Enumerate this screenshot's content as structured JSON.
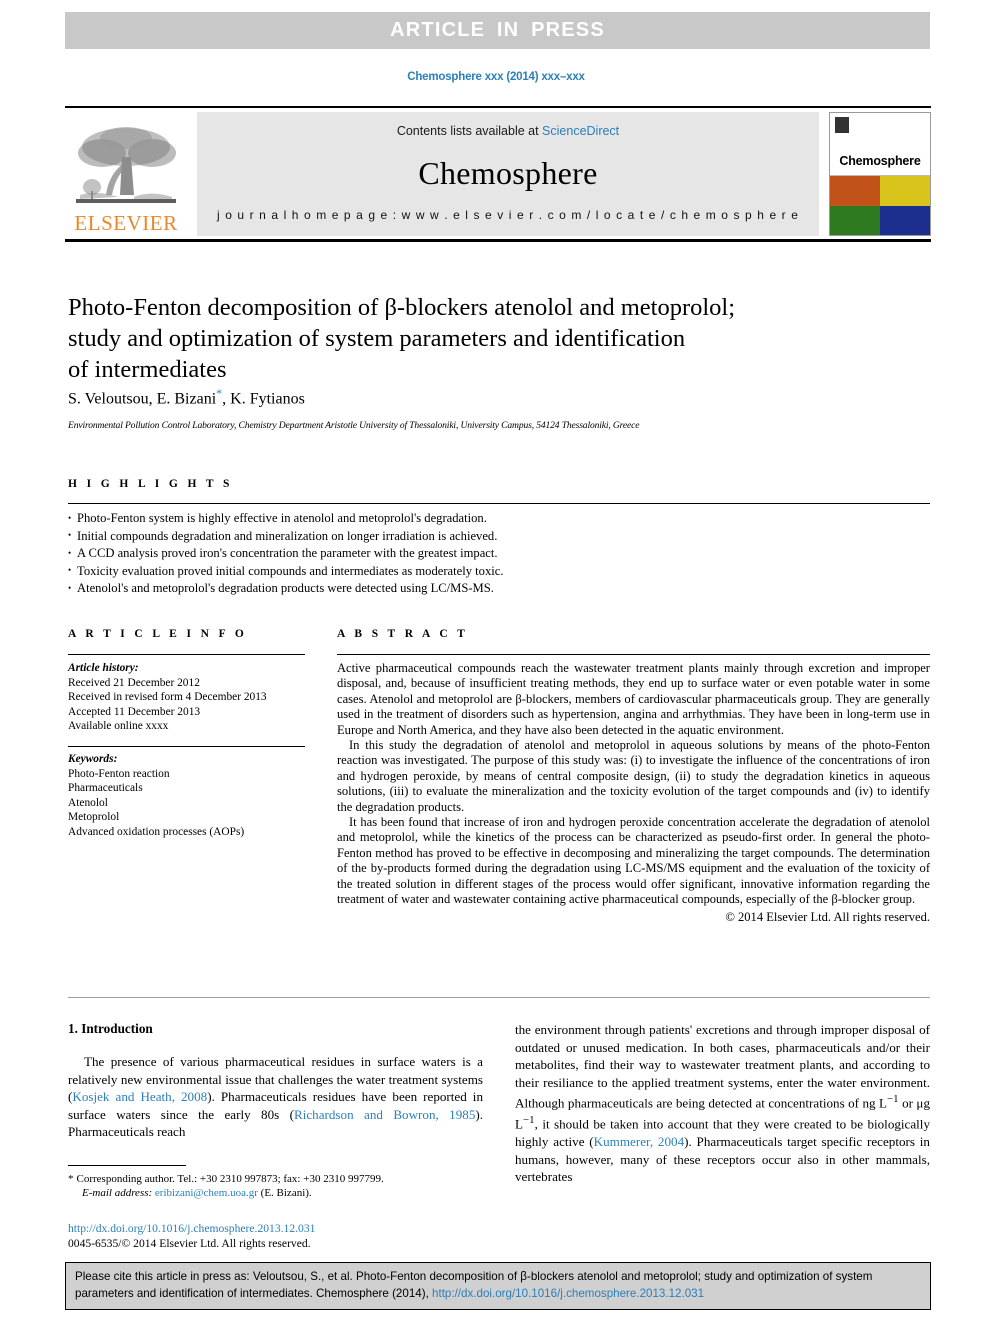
{
  "banner": {
    "text": "ARTICLE  IN  PRESS"
  },
  "running_head": "Chemosphere xxx (2014) xxx–xxx",
  "masthead": {
    "contents_prefix": "Contents lists available at ",
    "sciencedirect": "ScienceDirect",
    "journal_name": "Chemosphere",
    "homepage": "j o u r n a l   h o m e p a g e :   w w w . e l s e v i e r . c o m / l o c a t e / c h e m o s p h e r e",
    "elsevier_wordmark": "ELSEVIER",
    "cover_title": "Chemosphere",
    "cover_colors": [
      "#c0521a",
      "#d8c41b",
      "#2e7a1e",
      "#1c2f8e"
    ],
    "link_color": "#2b7fb9"
  },
  "article": {
    "title_line1": "Photo-Fenton decomposition of β-blockers atenolol and metoprolol;",
    "title_line2": "study and optimization of system parameters and identification",
    "title_line3": "of intermediates",
    "authors_part1": "S. Veloutsou, E. Bizani",
    "authors_star": "*",
    "authors_part2": ", K. Fytianos",
    "affiliation": "Environmental Pollution Control Laboratory, Chemistry Department Aristotle University of Thessaloniki, University Campus, 54124 Thessaloniki, Greece"
  },
  "highlights": {
    "label": "H I G H L I G H T S",
    "items": [
      "Photo-Fenton system is highly effective in atenolol and metoprolol's degradation.",
      "Initial compounds degradation and mineralization on longer irradiation is achieved.",
      "A CCD analysis proved iron's concentration the parameter with the greatest impact.",
      "Toxicity evaluation proved initial compounds and intermediates as moderately toxic.",
      "Atenolol's and metoprolol's degradation products were detected using LC/MS-MS."
    ]
  },
  "article_info": {
    "label": "A R T I C L E    I N F O",
    "history_heading": "Article history:",
    "history": [
      "Received 21 December 2012",
      "Received in revised form 4 December 2013",
      "Accepted 11 December 2013",
      "Available online xxxx"
    ],
    "keywords_heading": "Keywords:",
    "keywords": [
      "Photo-Fenton reaction",
      "Pharmaceuticals",
      "Atenolol",
      "Metoprolol",
      "Advanced oxidation processes (AOPs)"
    ]
  },
  "abstract": {
    "label": "A B S T R A C T",
    "paragraphs": [
      "Active pharmaceutical compounds reach the wastewater treatment plants mainly through excretion and improper disposal, and, because of insufficient treating methods, they end up to surface water or even potable water in some cases. Atenolol and metoprolol are β-blockers, members of cardiovascular pharmaceuticals group. They are generally used in the treatment of disorders such as hypertension, angina and arrhythmias. They have been in long-term use in Europe and North America, and they have also been detected in the aquatic environment.",
      "In this study the degradation of atenolol and metoprolol in aqueous solutions by means of the photo-Fenton reaction was investigated. The purpose of this study was: (i) to investigate the influence of the concentrations of iron and hydrogen peroxide, by means of central composite design, (ii) to study the degradation kinetics in aqueous solutions, (iii) to evaluate the mineralization and the toxicity evolution of the target compounds and (iv) to identify the degradation products.",
      "It has been found that increase of iron and hydrogen peroxide concentration accelerate the degradation of atenolol and metoprolol, while the kinetics of the process can be characterized as pseudo-first order. In general the photo-Fenton method has proved to be effective in decomposing and mineralizing the target compounds. The determination of the by-products formed during the degradation using LC-MS/MS equipment and the evaluation of the toxicity of the treated solution in different stages of the process would offer significant, innovative information regarding the treatment of water and wastewater containing active pharmaceutical compounds, especially of the β-blocker group."
    ],
    "copyright": "© 2014 Elsevier Ltd. All rights reserved."
  },
  "introduction": {
    "heading": "1. Introduction",
    "left_p1_a": "The presence of various pharmaceutical residues in surface waters is a relatively new environmental issue that challenges the water treatment systems (",
    "left_ref1": "Kosjek and Heath, 2008",
    "left_p1_b": "). Pharmaceuticals residues have been reported in surface waters since the early 80s (",
    "left_ref2": "Richardson and Bowron, 1985",
    "left_p1_c": "). Pharmaceuticals reach",
    "right_p1_a": "the environment through patients' excretions and through improper disposal of outdated or unused medication. In both cases, pharmaceuticals and/or their metabolites, find their way to wastewater treatment plants, and according to their resiliance to the applied treatment systems, enter the water environment. Although pharmaceuticals are being detected at concentrations of ng L",
    "right_sup1": "−1",
    "right_p1_b": " or μg L",
    "right_sup2": "−1",
    "right_p1_c": ", it should be taken into account that they were created to be biologically highly active (",
    "right_ref1": "Kummerer, 2004",
    "right_p1_d": "). Pharmaceuticals target specific receptors in humans, however, many of these receptors occur also in other mammals, vertebrates"
  },
  "footnote": {
    "star": "*",
    "corresponding": "Corresponding author. Tel.: +30 2310 997873; fax: +30 2310 997799.",
    "email_label": "E-mail address:",
    "email": "eribizani@chem.uoa.gr",
    "email_suffix": "(E. Bizani)."
  },
  "doi_block": {
    "doi_url": "http://dx.doi.org/10.1016/j.chemosphere.2013.12.031",
    "issn_line": "0045-6535/© 2014 Elsevier Ltd. All rights reserved."
  },
  "cite_box": {
    "text_a": "Please cite this article in press as: Veloutsou, S., et al. Photo-Fenton decomposition of β-blockers atenolol and metoprolol; study and optimization of system parameters and identification of intermediates. Chemosphere (2014), ",
    "link": "http://dx.doi.org/10.1016/j.chemosphere.2013.12.031"
  }
}
